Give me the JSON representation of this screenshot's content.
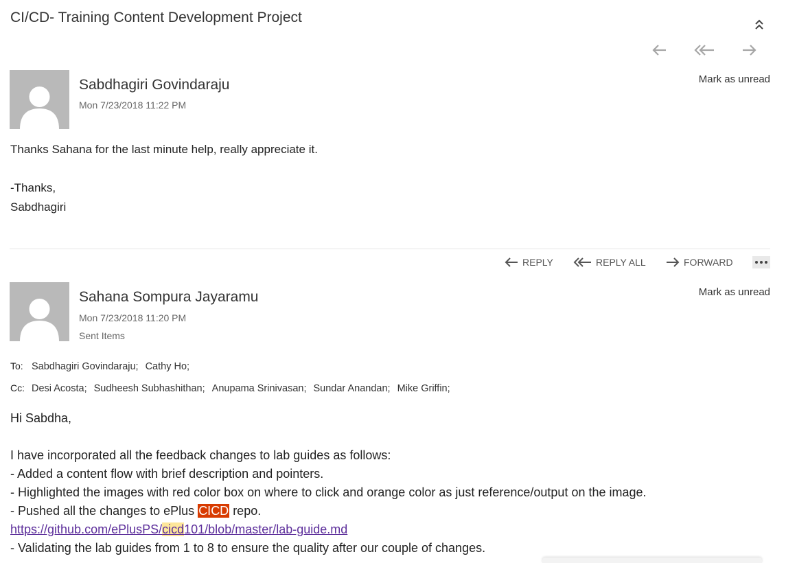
{
  "subject": "CI/CD- Training Content Development Project",
  "icons": {
    "collapse": "double-chevron-up-icon",
    "reply": "arrow-left-icon",
    "reply_all": "double-arrow-left-icon",
    "forward": "arrow-right-icon",
    "more": "ellipsis-icon",
    "avatar": "person-icon"
  },
  "colors": {
    "avatar_bg": "#b9b9b9",
    "highlight_red": "#d83b01",
    "highlight_yellow": "#fde69b",
    "link": "#5d2f9b"
  },
  "message1": {
    "sender": "Sabdhagiri Govindaraju",
    "date": "Mon 7/23/2018 11:22 PM",
    "mark_unread": "Mark as unread",
    "body": [
      "Thanks Sahana for the last minute help, really appreciate it.",
      "",
      "-Thanks,",
      "Sabdhagiri"
    ]
  },
  "actions": {
    "reply": "REPLY",
    "reply_all": "REPLY ALL",
    "forward": "FORWARD"
  },
  "message2": {
    "sender": "Sahana Sompura Jayaramu",
    "date": "Mon 7/23/2018 11:20 PM",
    "folder": "Sent Items",
    "mark_unread": "Mark as unread",
    "to_label": "To:",
    "to": [
      "Sabdhagiri Govindaraju;",
      "Cathy Ho;"
    ],
    "cc_label": "Cc:",
    "cc": [
      "Desi Acosta;",
      "Sudheesh Subhashithan;",
      "Anupama Srinivasan;",
      "Sundar Anandan;",
      "Mike Griffin;"
    ],
    "greeting": "Hi Sabdha,",
    "intro": "I have incorporated all the feedback changes to lab guides as follows:",
    "bullet1": "- Added a content flow with brief description and pointers.",
    "bullet2": "- Highlighted the images with red color box on where to click and orange color as just reference/output on the image.",
    "bullet3_prefix": "- Pushed all the changes to ePlus ",
    "bullet3_highlight": "CICD",
    "bullet3_suffix": " repo.",
    "link_prefix": "https://github.com/ePlusPS/",
    "link_highlight": "cicd",
    "link_suffix": "101/blob/master/lab-guide.md",
    "bullet4": "- Validating the lab guides from 1 to 8 to ensure the quality after our couple of changes."
  }
}
